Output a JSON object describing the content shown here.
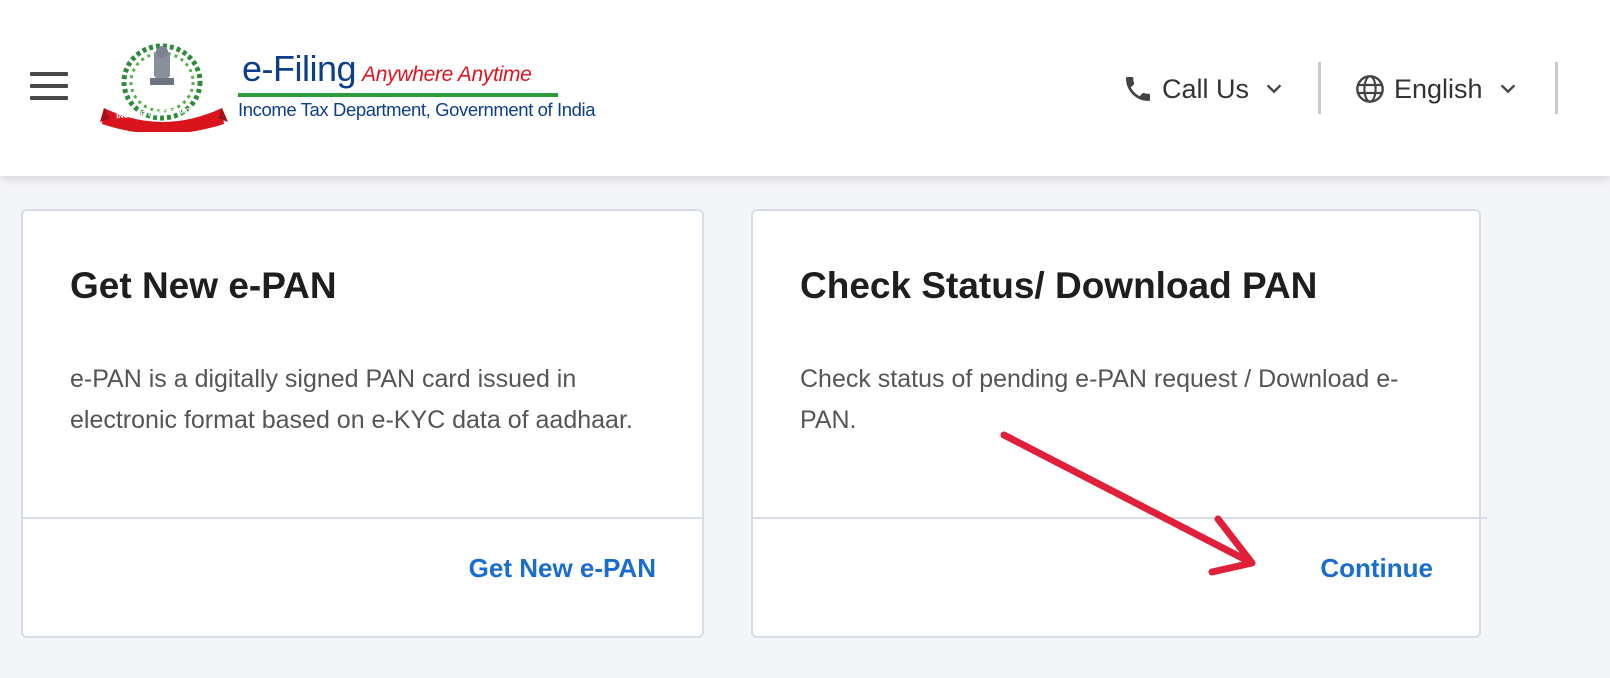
{
  "header": {
    "menu_icon": "hamburger-menu-icon",
    "logo": {
      "emblem_text": "INCOME TAX DEPARTMENT",
      "title": "e-Filing",
      "tagline": "Anywhere Anytime",
      "subtitle": "Income Tax Department, Government of India"
    },
    "call_us": {
      "label": "Call Us",
      "icon": "phone-icon"
    },
    "language": {
      "label": "English",
      "icon": "globe-icon"
    }
  },
  "cards": [
    {
      "title": "Get New e-PAN",
      "description": "e-PAN is a digitally signed PAN card issued in electronic format based on e-KYC data of aadhaar.",
      "action_label": "Get New e-PAN"
    },
    {
      "title": "Check Status/ Download PAN",
      "description": "Check status of pending e-PAN request / Download e-PAN.",
      "action_label": "Continue"
    }
  ],
  "colors": {
    "link": "#1a6dd0",
    "annotation_arrow": "#e0203a",
    "logo_blue": "#0d3e8a",
    "logo_red": "#e0141e",
    "logo_green": "#2e9a3c"
  }
}
